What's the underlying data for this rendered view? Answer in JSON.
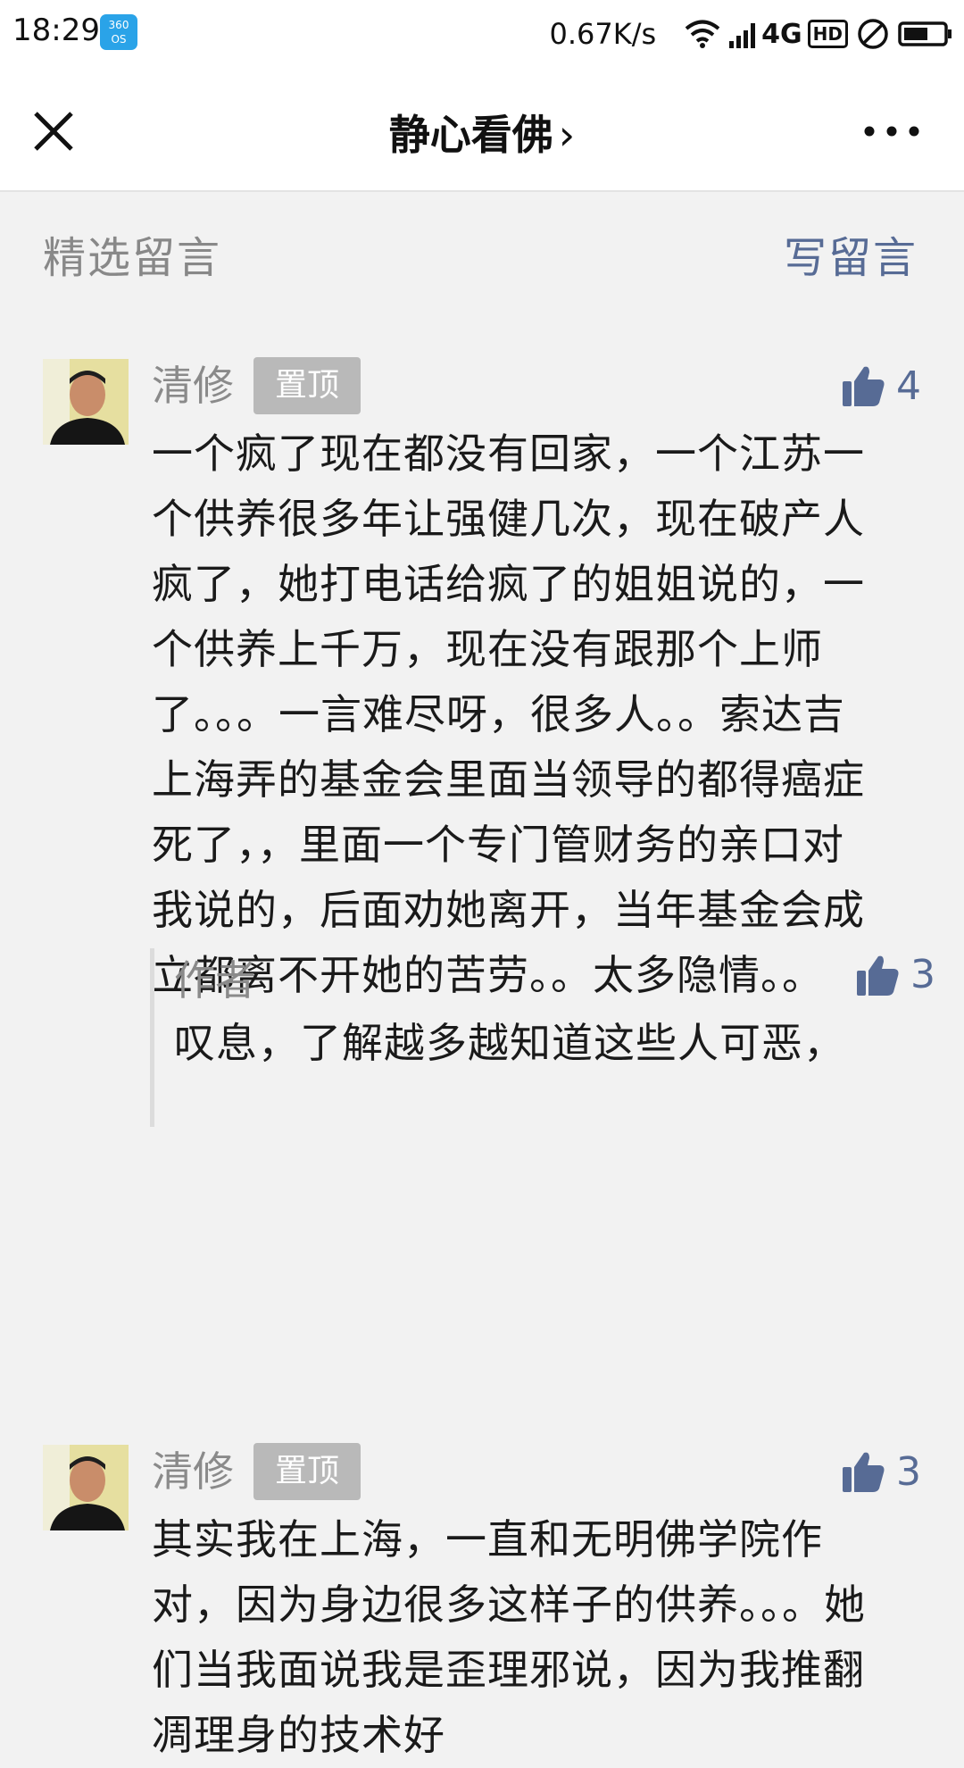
{
  "status_bar": {
    "time": "18:29",
    "os_badge_top": "360",
    "os_badge_bottom": "OS",
    "net_speed": "0.67K/s",
    "network": "4G",
    "hd": "HD"
  },
  "nav": {
    "title": "静心看佛",
    "chevron": "›",
    "icons": [
      "close-icon",
      "more-icon"
    ]
  },
  "section": {
    "title": "精选留言",
    "write_label": "写留言"
  },
  "comments": [
    {
      "name": "清修",
      "badge": "置顶",
      "likes": "4",
      "text": "一个疯了现在都没有回家，一个江苏一个供养很多年让强健几次，现在破产人疯了，她打电话给疯了的姐姐说的，一个供养上千万，现在没有跟那个上师了。。。一言难尽呀，很多人。。索达吉上海弄的基金会里面当领导的都得癌症死了，，里面一个专门管财务的亲口对我说的，后面劝她离开，当年基金会成立都离不开她的苦劳。。太多隐情。。",
      "reply": {
        "author": "作者",
        "likes": "3",
        "text": "叹息，了解越多越知道这些人可恶，"
      }
    },
    {
      "name": "清修",
      "badge": "置顶",
      "likes": "3",
      "text": "其实我在上海，一直和无明佛学院作对，因为身边很多这样子的供养。。。她们当我面说我是歪理邪说，因为我推翻凋理身的技术好"
    }
  ],
  "colors": {
    "link": "#576b95",
    "muted": "#888888",
    "badge_bg": "#b9b9b9",
    "page_bg": "#f2f2f2"
  }
}
